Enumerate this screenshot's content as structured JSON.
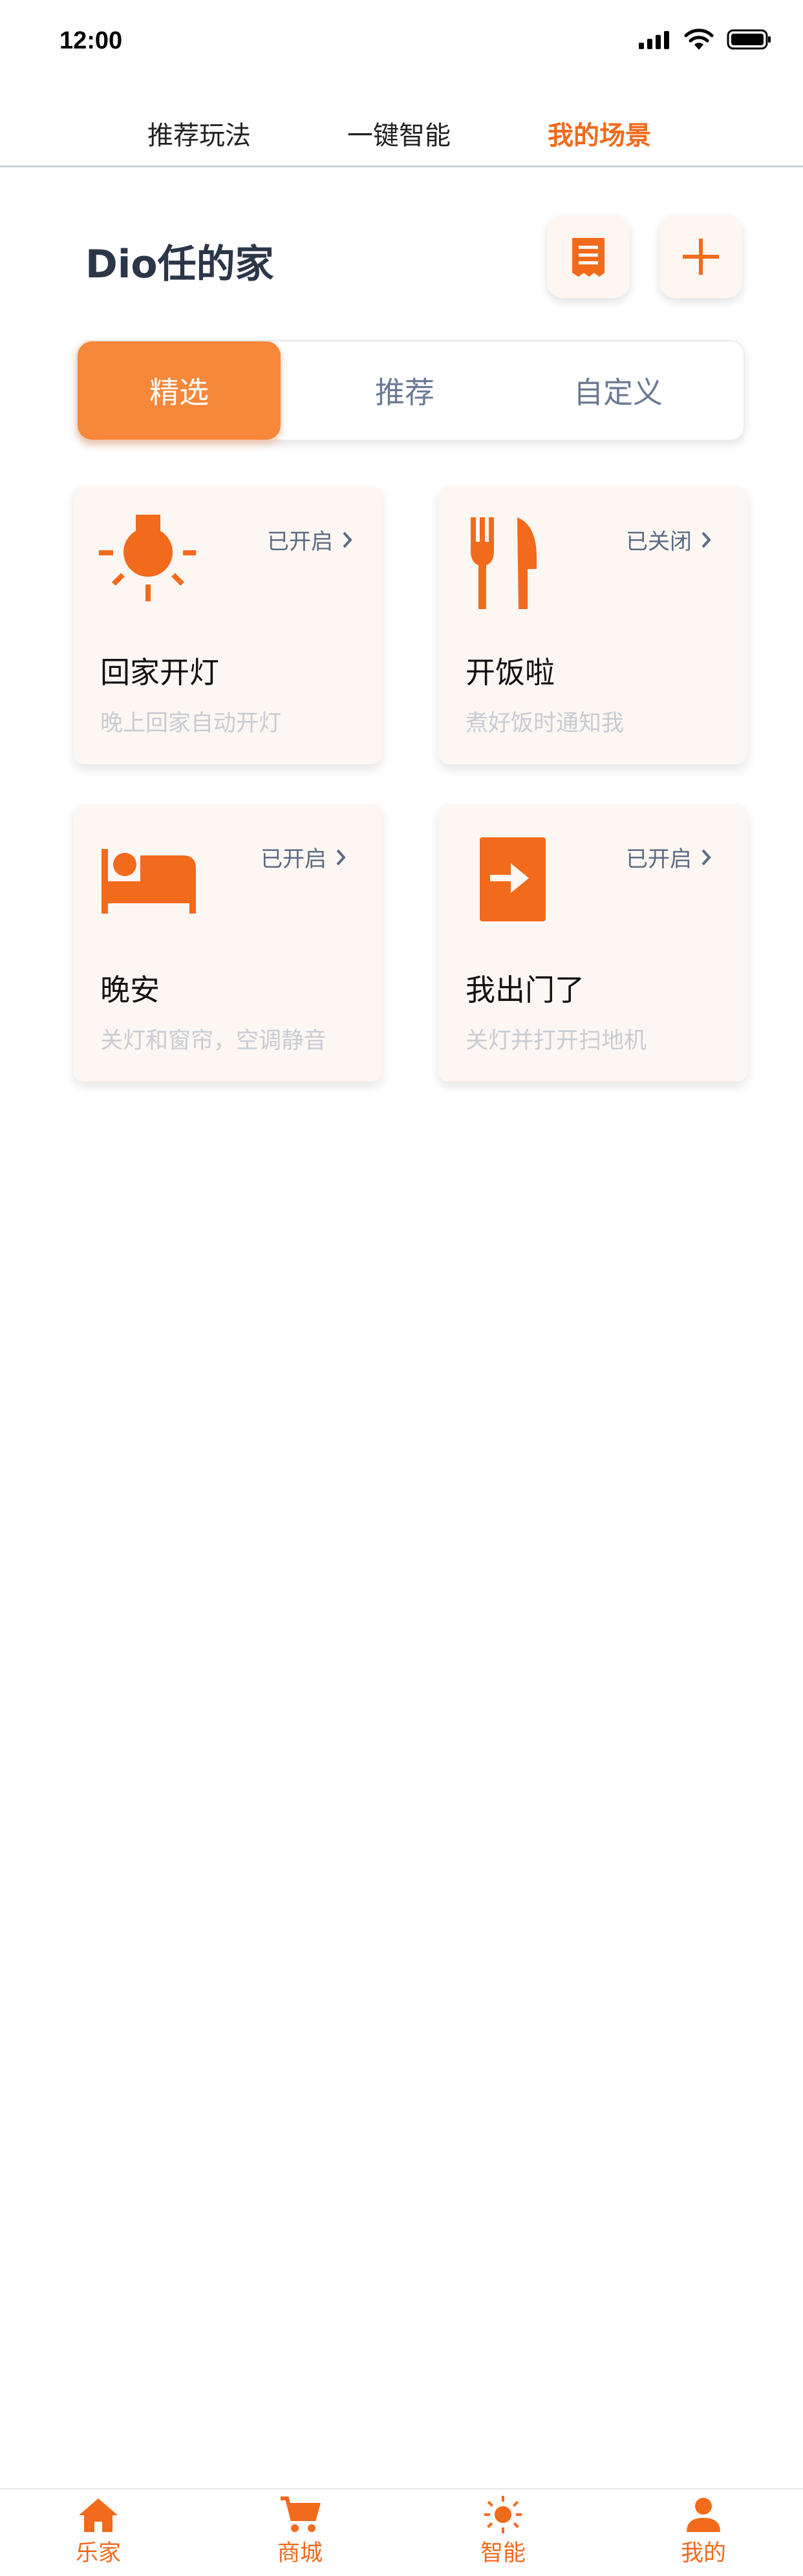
{
  "status_bar": {
    "time": "12:00"
  },
  "top_tabs": [
    {
      "label": "推荐玩法",
      "active": false
    },
    {
      "label": "一键智能",
      "active": false
    },
    {
      "label": "我的场景",
      "active": true
    }
  ],
  "home": {
    "title": "Dio任的家"
  },
  "header_actions": {
    "list_icon": "list-icon",
    "add_icon": "plus-icon"
  },
  "segments": [
    {
      "label": "精选",
      "active": true
    },
    {
      "label": "推荐",
      "active": false
    },
    {
      "label": "自定义",
      "active": false
    }
  ],
  "scenes": [
    {
      "icon": "lightbulb-icon",
      "status": "已开启",
      "title": "回家开灯",
      "desc": "晚上回家自动开灯"
    },
    {
      "icon": "fork-knife-icon",
      "status": "已关闭",
      "title": "开饭啦",
      "desc": "煮好饭时通知我"
    },
    {
      "icon": "bed-icon",
      "status": "已开启",
      "title": "晚安",
      "desc": "关灯和窗帘，空调静音"
    },
    {
      "icon": "exit-door-icon",
      "status": "已开启",
      "title": "我出门了",
      "desc": "关灯并打开扫地机"
    }
  ],
  "bottom_nav": [
    {
      "label": "乐家",
      "icon": "home-icon"
    },
    {
      "label": "商城",
      "icon": "cart-icon"
    },
    {
      "label": "智能",
      "icon": "sun-icon"
    },
    {
      "label": "我的",
      "icon": "user-icon"
    }
  ],
  "colors": {
    "accent": "#F26A1B",
    "accent_light": "#F7873A",
    "card_bg": "#FDF7F3",
    "title": "#2B3648"
  }
}
